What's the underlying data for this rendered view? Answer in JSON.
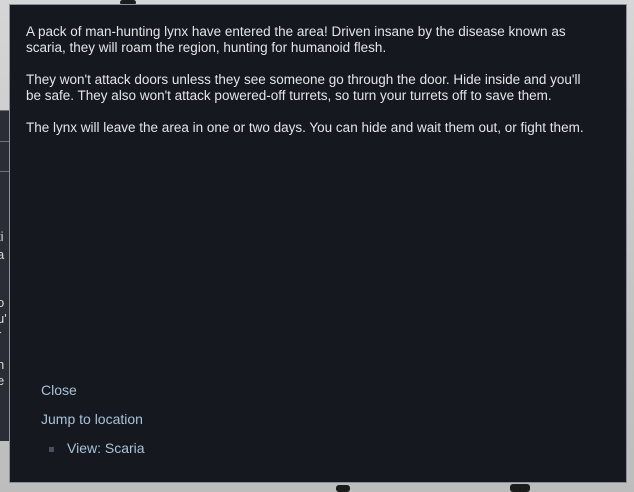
{
  "background": {
    "peek_lines": [
      "ti",
      "a",
      "o",
      "u'",
      "r",
      "h",
      "e"
    ]
  },
  "dialog": {
    "paragraphs": [
      "A pack of man-hunting lynx have entered the area! Driven insane by the disease known as scaria, they will roam the region, hunting for humanoid flesh.",
      "They won't attack doors unless they see someone go through the door. Hide inside and you'll be safe. They also won't attack powered-off turrets, so turn your turrets off to save them.",
      "The lynx will leave the area in one or two days. You can hide and wait them out, or fight them."
    ],
    "options": {
      "close": "Close",
      "jump": "Jump to location",
      "view": "View: Scaria"
    }
  }
}
